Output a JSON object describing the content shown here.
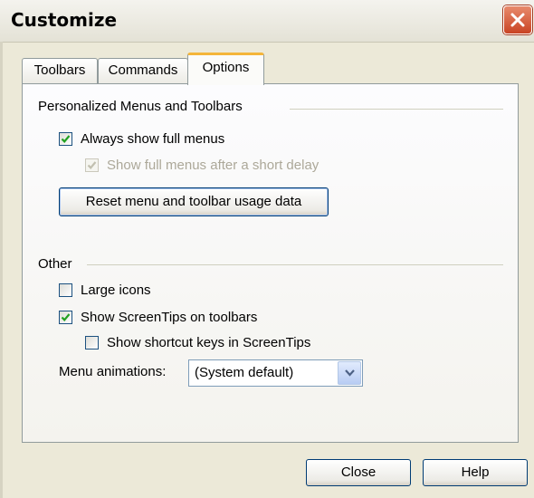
{
  "window": {
    "title": "Customize"
  },
  "tabs": [
    {
      "label": "Toolbars",
      "selected": false
    },
    {
      "label": "Commands",
      "selected": false
    },
    {
      "label": "Options",
      "selected": true
    }
  ],
  "personalized": {
    "heading": "Personalized Menus and Toolbars",
    "always_show_full_menus": {
      "label": "Always show full menus",
      "checked": true,
      "enabled": true
    },
    "show_after_delay": {
      "label": "Show full menus after a short delay",
      "checked": true,
      "enabled": false
    },
    "reset_button": "Reset menu and toolbar usage data"
  },
  "other": {
    "heading": "Other",
    "large_icons": {
      "label": "Large icons",
      "checked": false
    },
    "show_screentips": {
      "label": "Show ScreenTips on toolbars",
      "checked": true
    },
    "show_shortcut_keys": {
      "label": "Show shortcut keys in ScreenTips",
      "checked": false
    },
    "menu_animations_label": "Menu animations:",
    "menu_animations_value": "(System default)"
  },
  "footer": {
    "close_label": "Close",
    "help_label": "Help"
  },
  "colors": {
    "checkmark": "#21a121",
    "close_button": "#c94424",
    "tab_highlight": "#f4b53a"
  },
  "icons": {
    "close": "close-x-icon",
    "check": "checkmark-icon",
    "dropdown": "chevron-down-icon"
  }
}
